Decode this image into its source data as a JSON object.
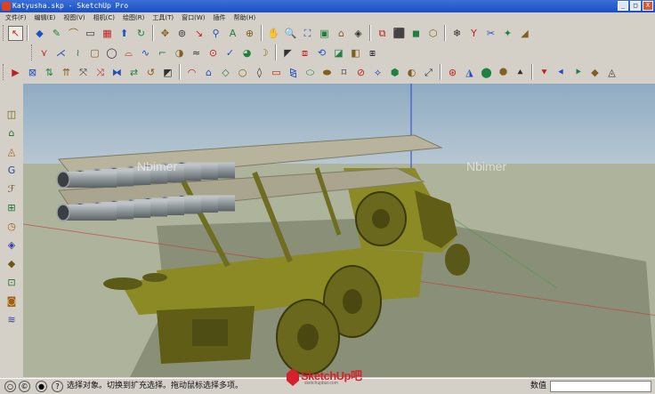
{
  "window": {
    "title": "Katyusha.skp - SketchUp Pro",
    "buttons": [
      "_",
      "□",
      "X"
    ]
  },
  "menu": [
    "文件(F)",
    "编辑(E)",
    "视图(V)",
    "相机(C)",
    "绘图(R)",
    "工具(T)",
    "窗口(W)",
    "插件",
    "帮助(H)"
  ],
  "toolbars": {
    "row1": [
      "↖",
      "◆",
      "✎",
      "⌒",
      "▭",
      "▦",
      "⬆",
      "↻",
      "✥",
      "⊚",
      "↘",
      "⚲",
      "A",
      "⊕",
      "✋",
      "🔍",
      "⛶",
      "▣",
      "⌂",
      "◈",
      "⧉",
      "⬛",
      "◼",
      "⬡",
      "❄",
      "Y",
      "✂",
      "✦",
      "◢"
    ],
    "row2": [
      "⋎",
      "⋌",
      "≀",
      "▢",
      "◯",
      "⌓",
      "∿",
      "⌐",
      "◑",
      "≈",
      "⊙",
      "✓",
      "◕",
      "☽",
      "◤",
      "⧈",
      "⟲",
      "◪",
      "◧",
      "⧆"
    ],
    "row3": [
      "▶",
      "⊠",
      "⇅",
      "⇈",
      "⤧",
      "⤨",
      "⧓",
      "⇄",
      "↺",
      "◩",
      "◠",
      "⌂",
      "◇",
      "○",
      "◊",
      "▭",
      "⧎",
      "⬭",
      "⬬",
      "⌑",
      "⊘",
      "⟡",
      "⬢",
      "◐",
      "⤢",
      "⊛",
      "◮",
      "⬤",
      "⯃",
      "⯅",
      "⯆",
      "⯇",
      "⯈",
      "◆",
      "◬"
    ],
    "left": [
      "◫",
      "⌂",
      "◬",
      "G",
      "ℱ",
      "⊞",
      "◷",
      "◈",
      "◆",
      "⊡",
      "◙",
      "≋"
    ]
  },
  "viewport": {
    "watermark": "Nbimer",
    "colors": {
      "sky": "#9bb4c8",
      "ground": "#aeb49c",
      "shadow": "#8a9077",
      "olive": "#8c8a25",
      "olive_dark": "#5f5d16",
      "tube": "#8e969a",
      "tube_end": "#3a3f44",
      "rail": "#a4a08a"
    }
  },
  "status": {
    "message": "选择对象。切换到扩充选择。拖动鼠标选择多项。",
    "value_label": "数值",
    "value_field": ""
  },
  "brand": {
    "name": "SketchUp吧",
    "url": "sketchupbar.com"
  }
}
